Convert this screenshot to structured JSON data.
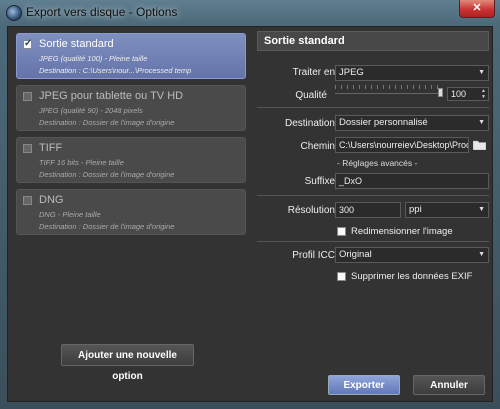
{
  "window": {
    "title": "Export vers disque - Options",
    "close_glyph": "✕"
  },
  "options": [
    {
      "title": "Sortie standard",
      "line1": "JPEG (qualité 100)  -  Pleine taille",
      "line2": "Destination : C:\\Users\\nour...\\Processed temp",
      "checked": true,
      "selected": true
    },
    {
      "title": "JPEG pour tablette ou TV HD",
      "line1": "JPEG (qualité 90)  -  2048 pixels",
      "line2": "Destination : Dossier de l'image d'origine",
      "checked": false,
      "selected": false
    },
    {
      "title": "TIFF",
      "line1": "TIFF 16 bits  -  Pleine taille",
      "line2": "Destination : Dossier de l'image d'origine",
      "checked": false,
      "selected": false
    },
    {
      "title": "DNG",
      "line1": "DNG  -  Pleine taille",
      "line2": "Destination : Dossier de l'image d'origine",
      "checked": false,
      "selected": false
    }
  ],
  "add_option_label": "Ajouter une nouvelle option",
  "panel": {
    "header": "Sortie standard",
    "format_label": "Traiter en",
    "format_value": "JPEG",
    "quality_label": "Qualité",
    "quality_value": "100",
    "quality_fraction": 1.0,
    "destination_label": "Destination",
    "destination_value": "Dossier personnalisé",
    "path_label": "Chemin",
    "path_value": "C:\\Users\\nourreiev\\Desktop\\Proc",
    "advanced_label": "- Réglages avancés -",
    "suffix_label": "Suffixe",
    "suffix_value": "_DxO",
    "resolution_label": "Résolution",
    "resolution_value": "300",
    "resolution_unit": "ppi",
    "resize_label": "Redimensionner l'image",
    "resize_checked": false,
    "icc_label": "Profil ICC",
    "icc_value": "Original",
    "exif_label": "Supprimer les données EXIF",
    "exif_checked": false
  },
  "buttons": {
    "export": "Exporter",
    "cancel": "Annuler"
  },
  "colors": {
    "selected_option": "#7080b8",
    "primary_button": "#7488c8"
  }
}
